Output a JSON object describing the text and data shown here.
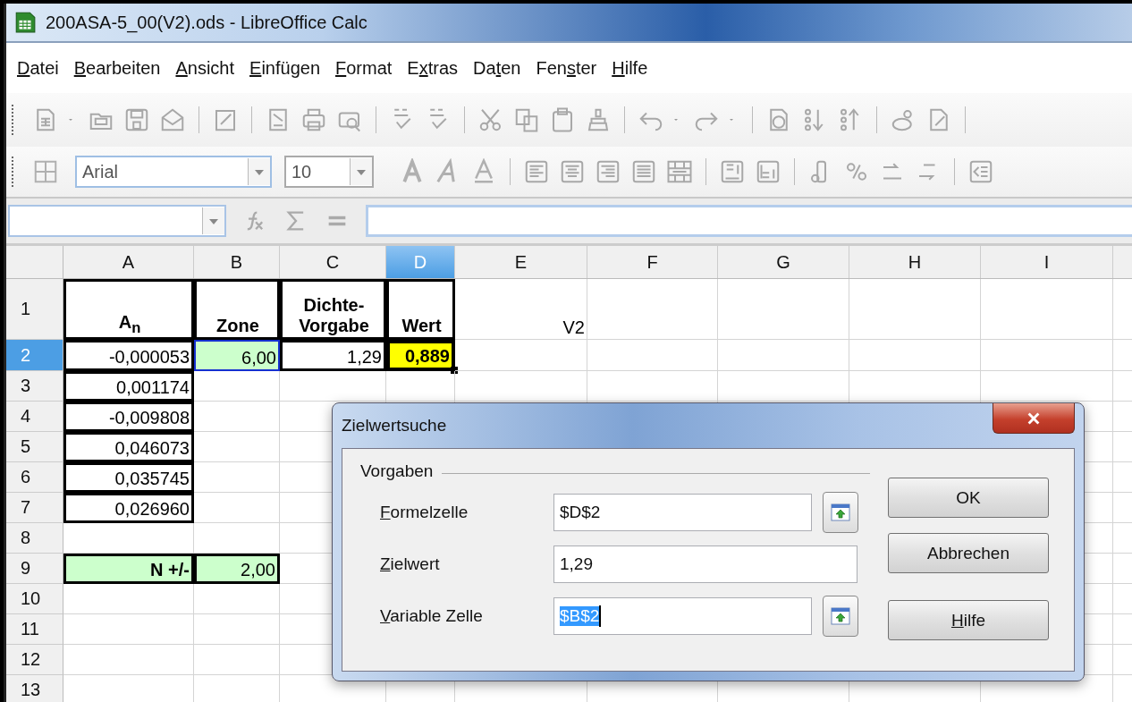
{
  "window": {
    "title": "200ASA-5_00(V2).ods - LibreOffice Calc"
  },
  "menu": [
    {
      "key": "D",
      "rest": "atei"
    },
    {
      "key": "B",
      "rest": "earbeiten"
    },
    {
      "key": "A",
      "rest": "nsicht"
    },
    {
      "key": "E",
      "rest": "infügen"
    },
    {
      "key": "F",
      "rest": "ormat"
    },
    {
      "lead": "E",
      "key": "x",
      "rest": "tras"
    },
    {
      "lead": "Da",
      "key": "t",
      "rest": "en"
    },
    {
      "lead": "Fen",
      "key": "s",
      "rest": "ter"
    },
    {
      "key": "H",
      "rest": "ilfe"
    }
  ],
  "formatting": {
    "font": "Arial",
    "size": "10"
  },
  "sheet": {
    "columns": [
      {
        "label": "A",
        "selected": false
      },
      {
        "label": "B",
        "selected": false
      },
      {
        "label": "C",
        "selected": false
      },
      {
        "label": "D",
        "selected": true
      },
      {
        "label": "E",
        "selected": false
      },
      {
        "label": "F",
        "selected": false
      },
      {
        "label": "G",
        "selected": false
      },
      {
        "label": "H",
        "selected": false
      },
      {
        "label": "I",
        "selected": false
      }
    ],
    "rows": [
      {
        "label": "1",
        "selected": false,
        "cells": [
          {
            "text": "A$_{n}$",
            "kind": "heading",
            "bold": true,
            "bordered": true
          },
          {
            "text": "Zone",
            "kind": "heading",
            "bold": true,
            "bordered": true
          },
          {
            "text": "Dichte-\nVorgabe",
            "kind": "heading",
            "bold": true,
            "bordered": true
          },
          {
            "text": "Wert",
            "kind": "heading",
            "bold": true,
            "bordered": true
          },
          {
            "text": "V2",
            "kind": "value"
          }
        ]
      },
      {
        "label": "2",
        "selected": true,
        "cells": [
          {
            "text": "-0,000053",
            "kind": "value",
            "bordered": true
          },
          {
            "text": "6,00",
            "kind": "value",
            "color": "#ccffcc",
            "referenced": true
          },
          {
            "text": "1,29",
            "kind": "value",
            "bordered": true
          },
          {
            "text": "0,889",
            "kind": "value",
            "bold": true,
            "color": "#ffff00",
            "bordered": true,
            "selected": true
          }
        ]
      },
      {
        "label": "3",
        "selected": false,
        "cells": [
          {
            "text": "0,001174",
            "kind": "value",
            "bordered": true
          }
        ]
      },
      {
        "label": "4",
        "selected": false,
        "cells": [
          {
            "text": "-0,009808",
            "kind": "value",
            "bordered": true
          }
        ]
      },
      {
        "label": "5",
        "selected": false,
        "cells": [
          {
            "text": "0,046073",
            "kind": "value",
            "bordered": true
          }
        ]
      },
      {
        "label": "6",
        "selected": false,
        "cells": [
          {
            "text": "0,035745",
            "kind": "value",
            "bordered": true
          }
        ]
      },
      {
        "label": "7",
        "selected": false,
        "cells": [
          {
            "text": "0,026960",
            "kind": "value",
            "bordered": true
          }
        ]
      },
      {
        "label": "8",
        "selected": false
      },
      {
        "label": "9",
        "selected": false,
        "cells": [
          {
            "text": "N +/-",
            "kind": "value",
            "bold": true,
            "color": "#ccffcc",
            "bordered": true
          },
          {
            "text": "2,00",
            "kind": "value",
            "color": "#ccffcc",
            "bordered": true
          }
        ]
      },
      {
        "label": "10",
        "selected": false
      },
      {
        "label": "11",
        "selected": false
      },
      {
        "label": "12",
        "selected": false
      },
      {
        "label": "13",
        "selected": false
      }
    ]
  },
  "dialog": {
    "title": "Zielwertsuche",
    "group": "Vorgaben",
    "fields": [
      {
        "label": {
          "key": "F",
          "rest": "ormelzelle"
        },
        "value": "$D$2",
        "picker": true,
        "focused": false
      },
      {
        "label": {
          "key": "Z",
          "rest": "ielwert"
        },
        "value": "1,29",
        "picker": false,
        "focused": false
      },
      {
        "label": {
          "key": "V",
          "rest": "ariable Zelle"
        },
        "value": "$B$2",
        "picker": true,
        "focused": true
      }
    ],
    "buttons": [
      {
        "label": {
          "rest": "OK"
        }
      },
      {
        "label": {
          "rest": "Abbrechen"
        }
      },
      {
        "label": {
          "key": "H",
          "rest": "ilfe"
        }
      }
    ]
  }
}
